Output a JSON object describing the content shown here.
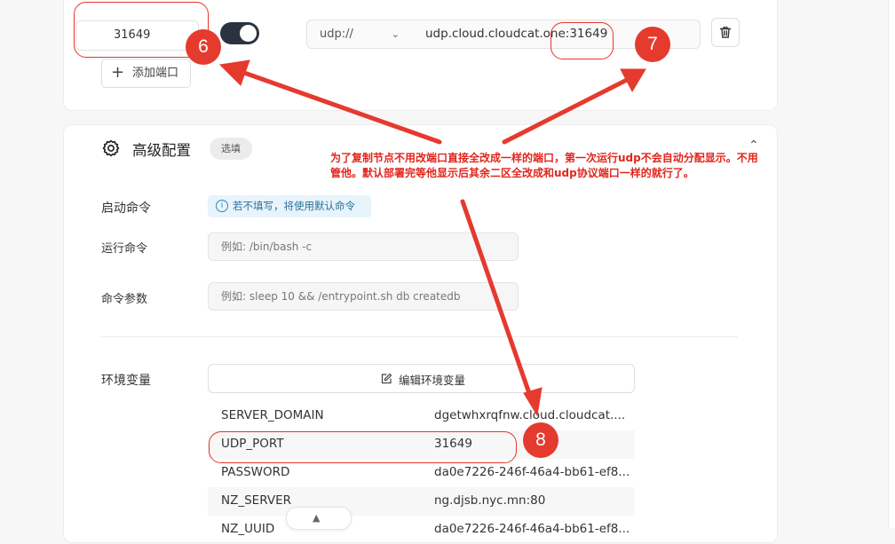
{
  "ports": {
    "port_value": "31649",
    "protocol": "udp://",
    "url": "udp.cloud.cloudcat.one:31649",
    "add_port_label": "添加端口"
  },
  "advanced": {
    "title": "高级配置",
    "badge": "选填",
    "start_command": {
      "label": "启动命令",
      "hint": "若不填写，将使用默认命令"
    },
    "run_command": {
      "label": "运行命令",
      "placeholder": "例如: /bin/bash -c"
    },
    "command_args": {
      "label": "命令参数",
      "placeholder": "例如: sleep 10 && /entrypoint.sh db createdb"
    },
    "env": {
      "label": "环境变量",
      "edit_button": "编辑环境变量",
      "rows": [
        {
          "key": "SERVER_DOMAIN",
          "value": "dgetwhxrqfnw.cloud.cloudcat...."
        },
        {
          "key": "UDP_PORT",
          "value": "31649"
        },
        {
          "key": "PASSWORD",
          "value": "da0e7226-246f-46a4-bb61-ef8..."
        },
        {
          "key": "NZ_SERVER",
          "value": "ng.djsb.nyc.mn:80"
        },
        {
          "key": "NZ_UUID",
          "value": "da0e7226-246f-46a4-bb61-ef8..."
        }
      ]
    }
  },
  "annotations": {
    "note_line1": "为了复制节点不用改端口直接全改成一样的端口，第一次运行udp不会自动分配显示。不用",
    "note_line2": "管他。默认部署完等他显示后其余二区全改成和udp协议端口一样的就行了。",
    "markers": [
      "6",
      "7",
      "8"
    ],
    "color": "#e53a2e"
  },
  "icons": {
    "toggle": "toggle-switch-on",
    "select_chevron": "chevron-down-icon",
    "delete": "trash-icon",
    "add": "plus-icon",
    "settings": "gear-icon",
    "collapse": "chevron-up-icon",
    "info": "info-icon",
    "edit": "edit-icon",
    "scroll_top": "triangle-up-icon"
  }
}
